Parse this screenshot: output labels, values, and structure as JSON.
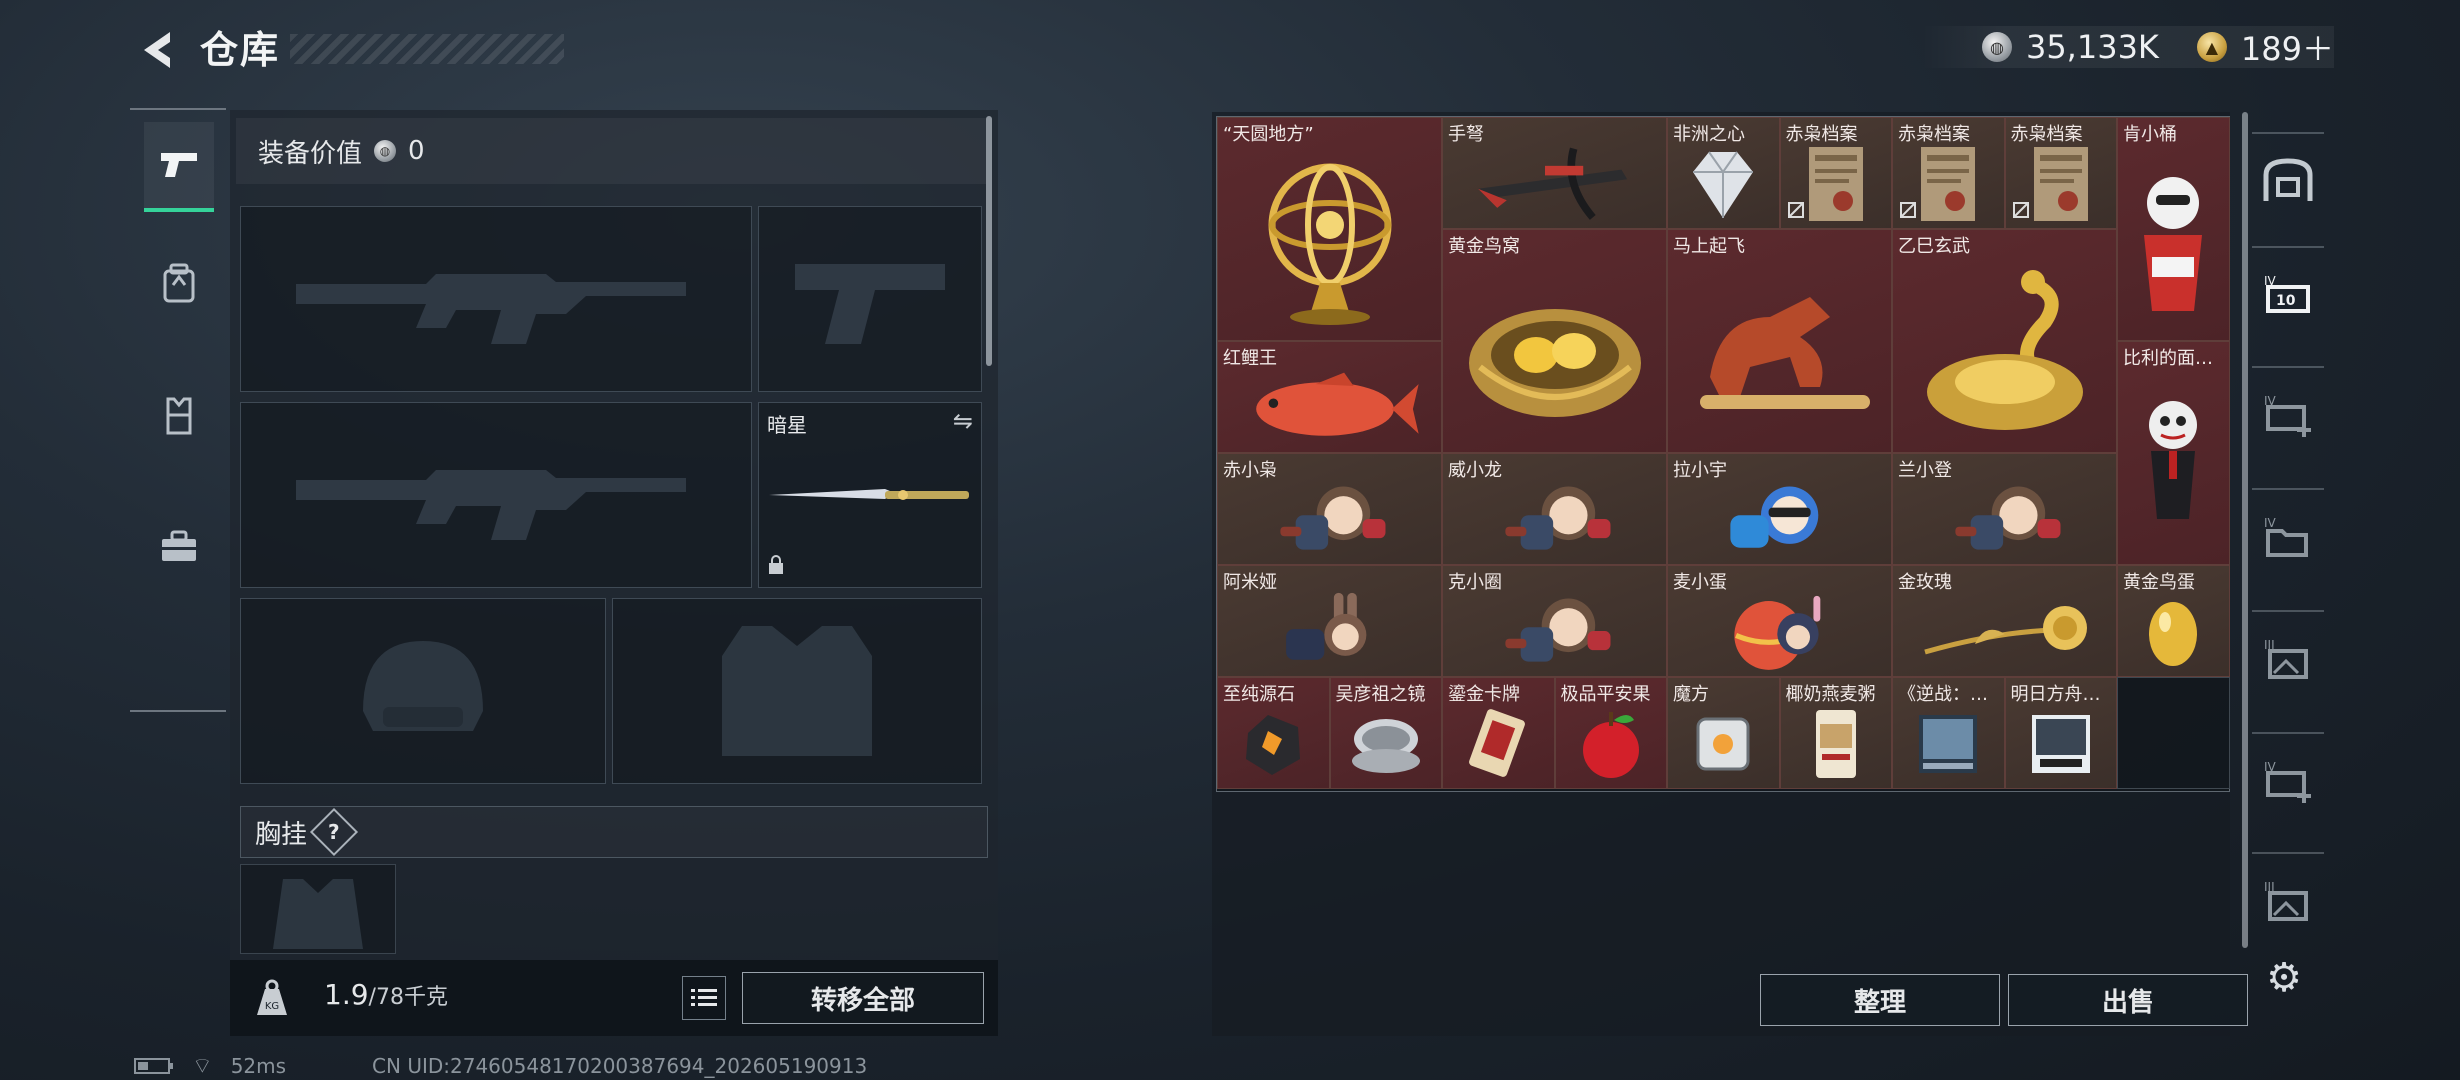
{
  "header": {
    "title": "仓库",
    "currency": [
      {
        "icon": "silver-coin-icon",
        "value": "35,133K"
      },
      {
        "icon": "gold-coin-icon",
        "value": "189＋"
      }
    ]
  },
  "left_nav": [
    {
      "icon": "pistol-icon",
      "active": true
    },
    {
      "icon": "backpack-icon",
      "active": false
    },
    {
      "icon": "vest-icon",
      "active": false
    },
    {
      "icon": "toolbox-icon",
      "active": false
    }
  ],
  "equipment": {
    "value_label": "装备价值",
    "value": "0",
    "knife_slot": {
      "label": "暗星",
      "swap_icon": "⇋",
      "lock_icon": "🔒"
    },
    "chest_rig_label": "胸挂",
    "help_symbol": "?",
    "weight_value": "1.9",
    "weight_capacity": "/78千克",
    "weight_icon": "KG",
    "transfer_all": "转移全部"
  },
  "inventory": {
    "items": [
      {
        "name": "“天圆地方”",
        "color": "red",
        "art": "armillary"
      },
      {
        "name": "手弩",
        "color": "brown",
        "art": "crossbow"
      },
      {
        "name": "非洲之心",
        "color": "brown",
        "art": "diamond"
      },
      {
        "name": "赤枭档案",
        "color": "brown",
        "art": "file",
        "broken": true
      },
      {
        "name": "赤枭档案",
        "color": "brown",
        "art": "file",
        "broken": true
      },
      {
        "name": "赤枭档案",
        "color": "brown",
        "art": "file",
        "broken": true
      },
      {
        "name": "肯小桶",
        "color": "red",
        "art": "bucket"
      },
      {
        "name": "黄金鸟窝",
        "color": "red",
        "art": "nest"
      },
      {
        "name": "马上起飞",
        "color": "red",
        "art": "horse"
      },
      {
        "name": "乙巳玄武",
        "color": "red",
        "art": "dragon"
      },
      {
        "name": "红鲤王",
        "color": "red",
        "art": "fish"
      },
      {
        "name": "比利的面…",
        "color": "red",
        "art": "puppet"
      },
      {
        "name": "赤小枭",
        "color": "brown",
        "art": "doll"
      },
      {
        "name": "威小龙",
        "color": "brown",
        "art": "doll"
      },
      {
        "name": "拉小宇",
        "color": "brown",
        "art": "doll-blue"
      },
      {
        "name": "兰小登",
        "color": "brown",
        "art": "doll"
      },
      {
        "name": "阿米娅",
        "color": "brown",
        "art": "doll-bunny"
      },
      {
        "name": "克小圈",
        "color": "brown",
        "art": "doll"
      },
      {
        "name": "麦小蛋",
        "color": "brown",
        "art": "egg-doll"
      },
      {
        "name": "金玫瑰",
        "color": "brown",
        "art": "rose"
      },
      {
        "name": "黄金鸟蛋",
        "color": "brown",
        "art": "gold-egg"
      },
      {
        "name": "至纯源石",
        "color": "red",
        "art": "ore"
      },
      {
        "name": "吴彦祖之镜",
        "color": "red",
        "art": "mirror"
      },
      {
        "name": "鎏金卡牌",
        "color": "red",
        "art": "card"
      },
      {
        "name": "极品平安果",
        "color": "red",
        "art": "apple"
      },
      {
        "name": "魔方",
        "color": "brown",
        "art": "cube"
      },
      {
        "name": "椰奶燕麦粥",
        "color": "brown",
        "art": "can"
      },
      {
        "name": "《逆战：…",
        "color": "brown",
        "art": "box"
      },
      {
        "name": "明日方舟…",
        "color": "brown",
        "art": "box-white"
      }
    ],
    "sort": "整理",
    "sell": "出售"
  },
  "right_nav": [
    {
      "icon": "safe-box-icon"
    },
    {
      "icon": "case-iv-10-icon"
    },
    {
      "icon": "add-case-iv-icon"
    },
    {
      "icon": "folder-iv-icon"
    },
    {
      "icon": "image-case-iii-icon"
    },
    {
      "icon": "add-case-iv-icon-2"
    },
    {
      "icon": "image-case-iii-icon-2"
    }
  ],
  "status": {
    "ping": "52ms",
    "uid": "CN UID:27460548170200387694_202605190913"
  },
  "colors": {
    "accent_green": "#35d39a",
    "cell_red": "#5c2a2e",
    "cell_brown": "#4a3a32"
  }
}
